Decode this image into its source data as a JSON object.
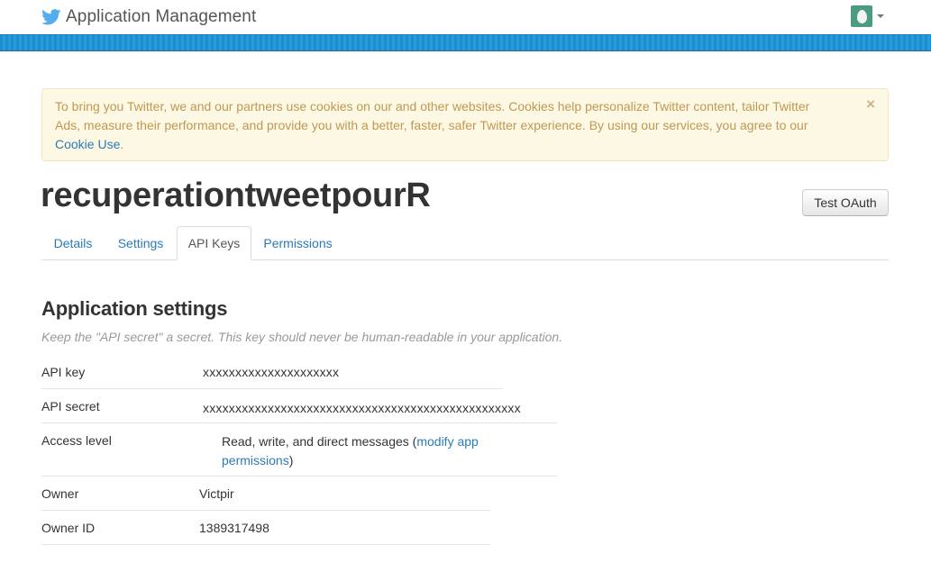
{
  "header": {
    "title": "Application Management",
    "logo_icon": "twitter-bird-icon",
    "avatar_icon": "default-egg-avatar-icon",
    "brand_color": "#55acee",
    "stripe_color": "#1a8ed0"
  },
  "cookie_notice": {
    "text_before": "To bring you Twitter, we and our partners use cookies on our and other websites. Cookies help personalize Twitter content, tailor Twitter Ads, measure their performance, and provide you with a better, faster, safer Twitter experience. By using our services, you agree to our ",
    "link_text": "Cookie Use",
    "text_after": ".",
    "close_label": "×",
    "background_color": "#fcf8e3",
    "text_color": "#c09853"
  },
  "app": {
    "name": "recuperationtweetpourR",
    "test_oauth_label": "Test OAuth"
  },
  "tabs": [
    {
      "label": "Details",
      "active": false
    },
    {
      "label": "Settings",
      "active": false
    },
    {
      "label": "API Keys",
      "active": true
    },
    {
      "label": "Permissions",
      "active": false
    }
  ],
  "settings": {
    "title": "Application settings",
    "subtitle": "Keep the \"API secret\" a secret. This key should never be human-readable in your application.",
    "rows": [
      {
        "label": "API key",
        "value": "xxxxxxxxxxxxxxxxxxxxx"
      },
      {
        "label": "API secret",
        "value": "xxxxxxxxxxxxxxxxxxxxxxxxxxxxxxxxxxxxxxxxxxxxxxxxx"
      },
      {
        "label": "Access level",
        "value_before": "Read, write, and direct messages (",
        "link_text": "modify app permissions",
        "value_after": ")"
      },
      {
        "label": "Owner",
        "value": "Victpir"
      },
      {
        "label": "Owner ID",
        "value": "1389317498"
      }
    ]
  }
}
